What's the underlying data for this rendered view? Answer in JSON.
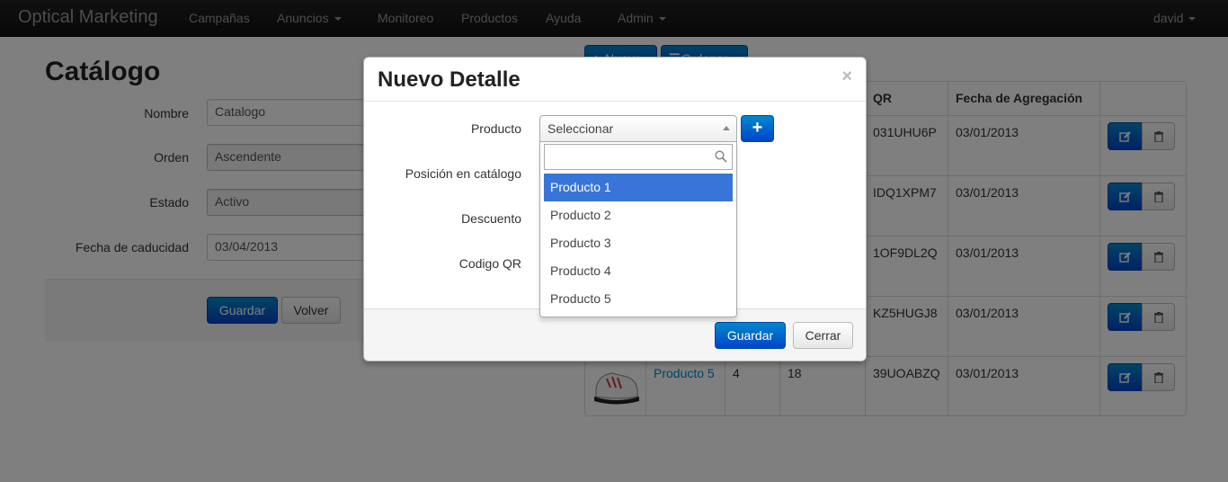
{
  "navbar": {
    "brand": "Optical Marketing",
    "items": [
      {
        "label": "Campañas",
        "dropdown": false
      },
      {
        "label": "Anuncios",
        "dropdown": true
      },
      {
        "label": "Monitoreo",
        "dropdown": false
      },
      {
        "label": "Productos",
        "dropdown": false
      },
      {
        "label": "Ayuda",
        "dropdown": false
      },
      {
        "label": "Admin",
        "dropdown": true
      }
    ],
    "user": "david"
  },
  "page": {
    "title": "Catálogo",
    "form": {
      "fields": [
        {
          "label": "Nombre",
          "value": "Catalogo"
        },
        {
          "label": "Orden",
          "value": "Ascendente"
        },
        {
          "label": "Estado",
          "value": "Activo"
        },
        {
          "label": "Fecha de caducidad",
          "value": "03/04/2013"
        }
      ],
      "save_label": "Guardar",
      "back_label": "Volver"
    }
  },
  "table": {
    "top_buttons": {
      "new_label": "Nuevo",
      "order_label": "Ordenar"
    },
    "headers": {
      "qr": "QR",
      "date": "Fecha de Agregación"
    },
    "rows": [
      {
        "product": "",
        "position": "",
        "discount": "",
        "qr": "031UHU6P",
        "date": "03/01/2013"
      },
      {
        "product": "",
        "position": "",
        "discount": "",
        "qr": "IDQ1XPM7",
        "date": "03/01/2013"
      },
      {
        "product": "",
        "position": "",
        "discount": "",
        "qr": "1OF9DL2Q",
        "date": "03/01/2013"
      },
      {
        "product": "",
        "position": "",
        "discount": "",
        "qr": "KZ5HUGJ8",
        "date": "03/01/2013"
      },
      {
        "product": "Producto 5",
        "position": "4",
        "discount": "18",
        "qr": "39UOABZQ",
        "date": "03/01/2013"
      }
    ]
  },
  "modal": {
    "title": "Nuevo Detalle",
    "close_glyph": "×",
    "labels": {
      "product": "Producto",
      "position": "Posición en catálogo",
      "discount": "Descuento",
      "qr": "Codigo QR"
    },
    "select": {
      "selected": "Seleccionar"
    },
    "dropdown": {
      "options": [
        "Producto 1",
        "Producto 2",
        "Producto 3",
        "Producto 4",
        "Producto 5"
      ],
      "highlighted_index": 0
    },
    "save_label": "Guardar",
    "close_label": "Cerrar"
  },
  "colors": {
    "primary": "#0055cc",
    "highlight": "#3875d7",
    "link": "#0088cc",
    "navbar": "#1b1b1b"
  }
}
